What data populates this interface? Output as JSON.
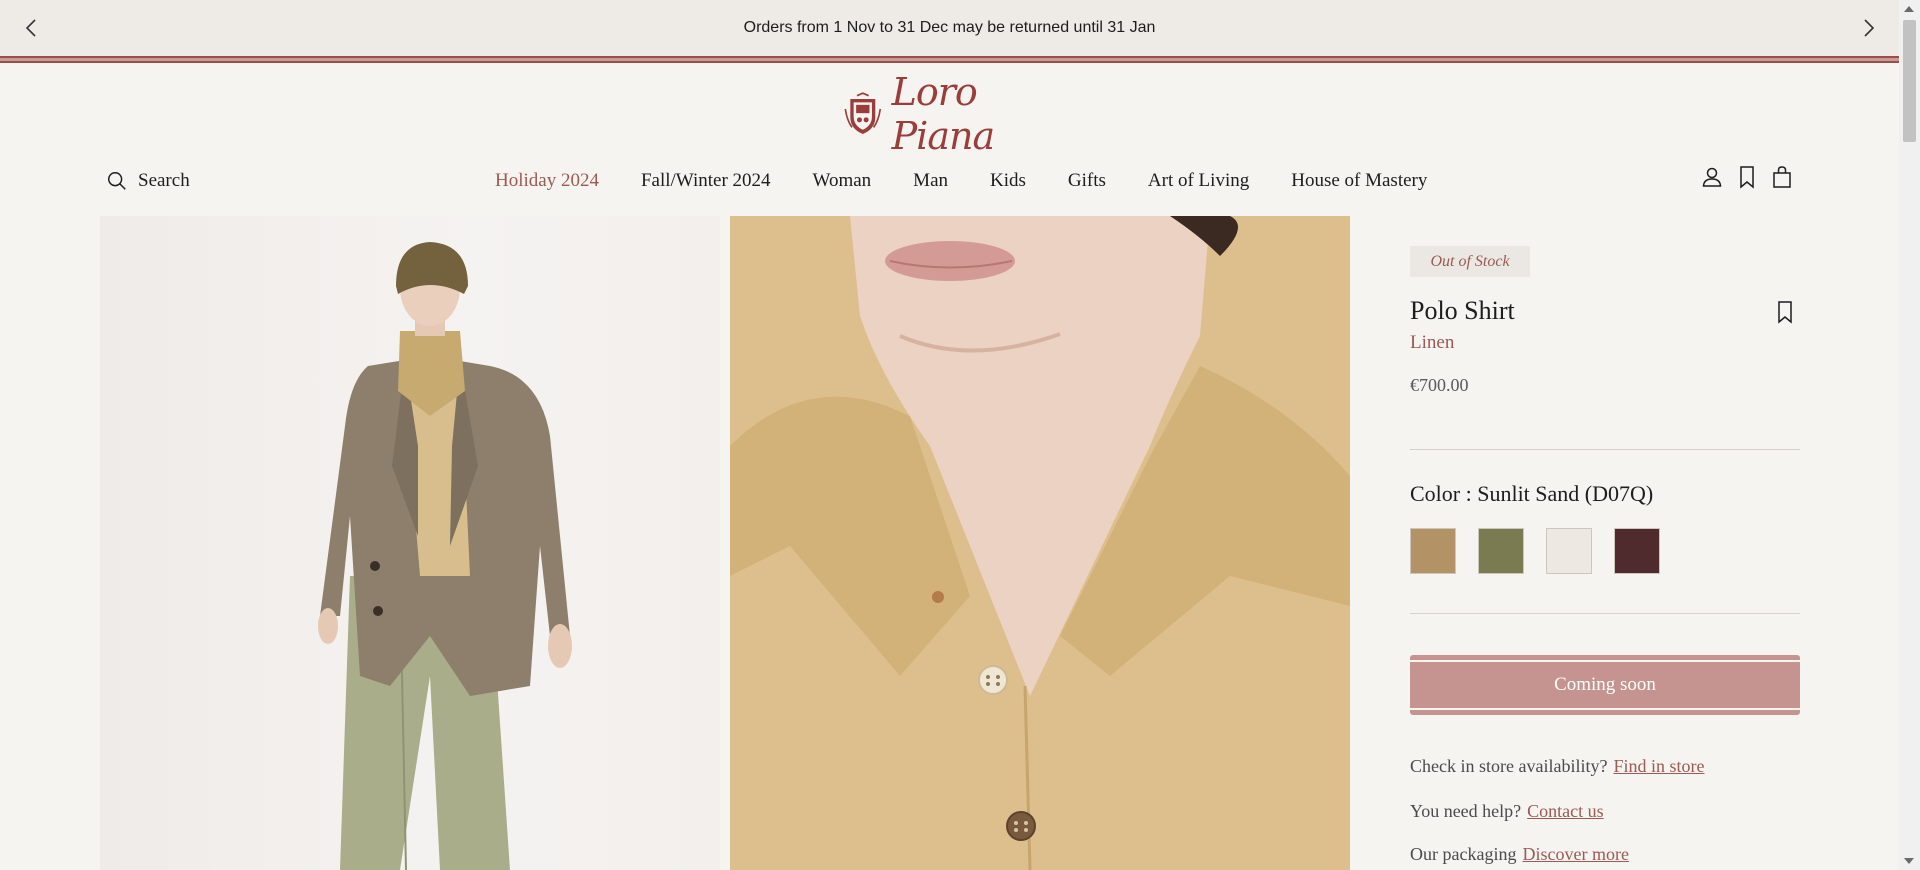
{
  "announcement": {
    "message": "Orders from 1 Nov to 31 Dec may be returned until 31 Jan"
  },
  "brand": {
    "name": "Loro Piana"
  },
  "header": {
    "search_label": "Search",
    "nav": [
      "Holiday 2024",
      "Fall/Winter 2024",
      "Woman",
      "Man",
      "Kids",
      "Gifts",
      "Art of Living",
      "House of Mastery"
    ]
  },
  "product": {
    "status_badge": "Out of Stock",
    "name": "Polo Shirt",
    "material": "Linen",
    "price": "€700.00",
    "color_label": "Color : Sunlit Sand (D07Q)",
    "swatches": [
      "#b39265",
      "#7b7b52",
      "#ede8e1",
      "#4f2b2e"
    ],
    "cta_label": "Coming soon"
  },
  "help": {
    "store_question": "Check in store availability?",
    "store_link": "Find in store",
    "help_question": "You need help?",
    "help_link": "Contact us",
    "packaging_question": "Our packaging",
    "packaging_link": "Discover more"
  },
  "colors": {
    "accent": "#9b5a53",
    "cta_bg": "#c59490",
    "brand_red": "#9b3e3b"
  }
}
